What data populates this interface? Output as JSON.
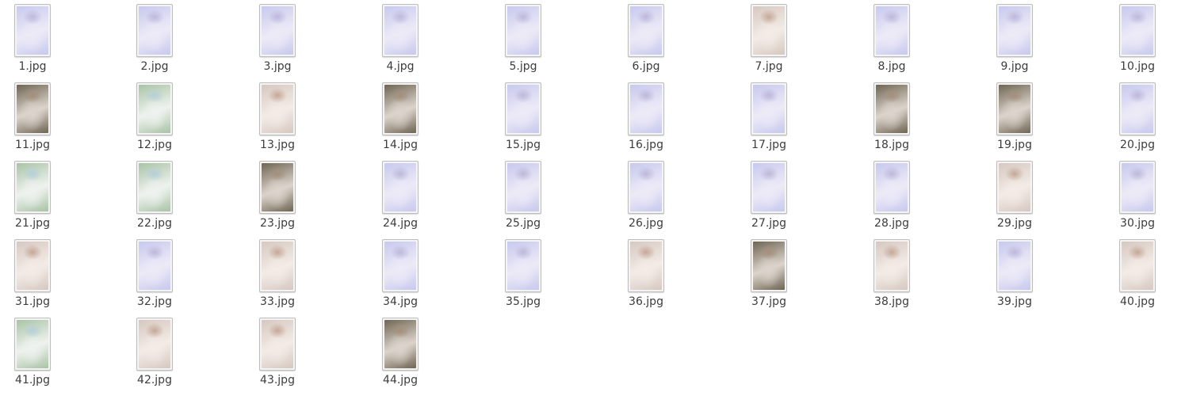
{
  "files": [
    {
      "name": "1.jpg",
      "tone": "lavender"
    },
    {
      "name": "2.jpg",
      "tone": "lavender"
    },
    {
      "name": "3.jpg",
      "tone": "lavender"
    },
    {
      "name": "4.jpg",
      "tone": "lavender"
    },
    {
      "name": "5.jpg",
      "tone": "lavender"
    },
    {
      "name": "6.jpg",
      "tone": "lavender"
    },
    {
      "name": "7.jpg",
      "tone": "warm"
    },
    {
      "name": "8.jpg",
      "tone": "lavender"
    },
    {
      "name": "9.jpg",
      "tone": "lavender"
    },
    {
      "name": "10.jpg",
      "tone": "lavender"
    },
    {
      "name": "11.jpg",
      "tone": "dark"
    },
    {
      "name": "12.jpg",
      "tone": "green"
    },
    {
      "name": "13.jpg",
      "tone": "warm"
    },
    {
      "name": "14.jpg",
      "tone": "dark"
    },
    {
      "name": "15.jpg",
      "tone": "lavender"
    },
    {
      "name": "16.jpg",
      "tone": "lavender"
    },
    {
      "name": "17.jpg",
      "tone": "lavender"
    },
    {
      "name": "18.jpg",
      "tone": "dark"
    },
    {
      "name": "19.jpg",
      "tone": "dark"
    },
    {
      "name": "20.jpg",
      "tone": "lavender"
    },
    {
      "name": "21.jpg",
      "tone": "green"
    },
    {
      "name": "22.jpg",
      "tone": "green"
    },
    {
      "name": "23.jpg",
      "tone": "dark"
    },
    {
      "name": "24.jpg",
      "tone": "lavender"
    },
    {
      "name": "25.jpg",
      "tone": "lavender"
    },
    {
      "name": "26.jpg",
      "tone": "lavender"
    },
    {
      "name": "27.jpg",
      "tone": "lavender"
    },
    {
      "name": "28.jpg",
      "tone": "lavender"
    },
    {
      "name": "29.jpg",
      "tone": "warm"
    },
    {
      "name": "30.jpg",
      "tone": "lavender"
    },
    {
      "name": "31.jpg",
      "tone": "warm"
    },
    {
      "name": "32.jpg",
      "tone": "lavender"
    },
    {
      "name": "33.jpg",
      "tone": "warm"
    },
    {
      "name": "34.jpg",
      "tone": "lavender"
    },
    {
      "name": "35.jpg",
      "tone": "lavender"
    },
    {
      "name": "36.jpg",
      "tone": "warm"
    },
    {
      "name": "37.jpg",
      "tone": "dark"
    },
    {
      "name": "38.jpg",
      "tone": "warm"
    },
    {
      "name": "39.jpg",
      "tone": "lavender"
    },
    {
      "name": "40.jpg",
      "tone": "warm"
    },
    {
      "name": "41.jpg",
      "tone": "green"
    },
    {
      "name": "42.jpg",
      "tone": "warm"
    },
    {
      "name": "43.jpg",
      "tone": "warm"
    },
    {
      "name": "44.jpg",
      "tone": "dark"
    }
  ],
  "tones": {
    "lavender": [
      "#c7c9ee",
      "#edeaf7",
      "#bdb8da"
    ],
    "warm": [
      "#d6c8c0",
      "#f3ebe6",
      "#c5a898"
    ],
    "dark": [
      "#6f6553",
      "#dcd4cc",
      "#a48f7c"
    ],
    "green": [
      "#a9c3a6",
      "#eef2ee",
      "#b5cfd9"
    ]
  }
}
